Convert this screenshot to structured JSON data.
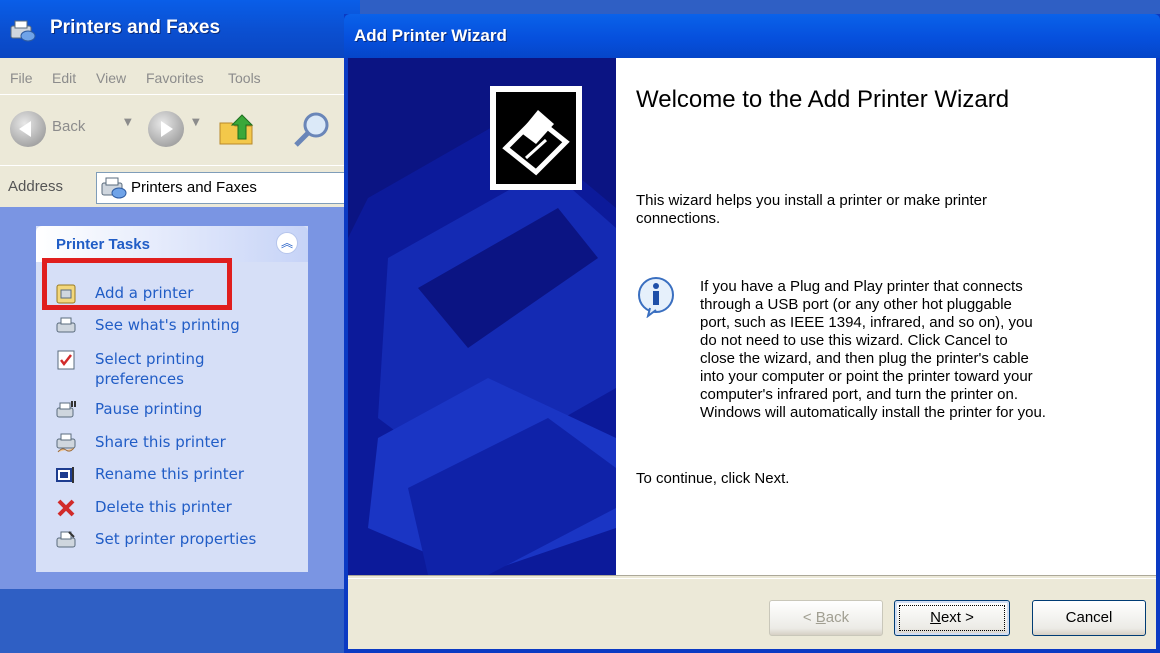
{
  "explorer": {
    "title": "Printers and Faxes",
    "menu": [
      "File",
      "Edit",
      "View",
      "Favorites",
      "Tools"
    ],
    "toolbar": {
      "back_label": "Back"
    },
    "address": {
      "label": "Address",
      "value": "Printers and Faxes"
    },
    "task_panel": {
      "title": "Printer Tasks",
      "items": [
        {
          "label": "Add a printer",
          "icon": "add-printer-icon"
        },
        {
          "label": "See what's printing",
          "icon": "printer-icon"
        },
        {
          "label": "Select printing preferences",
          "icon": "checklist-icon"
        },
        {
          "label": "Pause printing",
          "icon": "pause-printer-icon"
        },
        {
          "label": "Share this printer",
          "icon": "share-printer-icon"
        },
        {
          "label": "Rename this printer",
          "icon": "rename-icon"
        },
        {
          "label": "Delete this printer",
          "icon": "delete-x-icon"
        },
        {
          "label": "Set printer properties",
          "icon": "printer-properties-icon"
        }
      ]
    },
    "highlight_color": "#e01e1e"
  },
  "wizard": {
    "title": "Add Printer Wizard",
    "heading": "Welcome to the Add Printer Wizard",
    "intro": "This wizard helps you install a printer or make printer connections.",
    "info_lines": [
      "If you have a Plug and Play printer that connects",
      "through a USB port (or any other hot pluggable",
      "port, such as IEEE 1394, infrared, and so on), you",
      "do not need to use this wizard. Click Cancel to",
      "close the wizard, and then plug the printer's cable",
      "into your computer or point the printer toward your",
      "computer's infrared port, and turn the printer on.",
      "Windows will automatically install the printer for you."
    ],
    "continue_text": "To continue, click Next.",
    "buttons": {
      "back": {
        "prefix": "< ",
        "mnemonic": "B",
        "rest": "ack"
      },
      "next": {
        "mnemonic": "N",
        "rest": "ext >"
      },
      "cancel": "Cancel"
    }
  }
}
